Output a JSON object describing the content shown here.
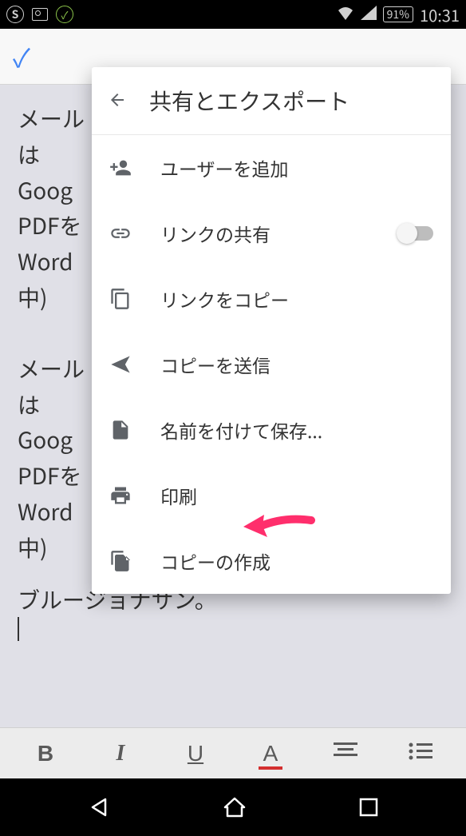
{
  "status_bar": {
    "battery": "91%",
    "time": "10:31"
  },
  "menu": {
    "title": "共有とエクスポート",
    "items": [
      {
        "label": "ユーザーを追加"
      },
      {
        "label": "リンクの共有"
      },
      {
        "label": "リンクをコピー"
      },
      {
        "label": "コピーを送信"
      },
      {
        "label": "名前を付けて保存..."
      },
      {
        "label": "印刷"
      },
      {
        "label": "コピーの作成"
      }
    ]
  },
  "document": {
    "block1": "メール\nは\nGoog\nPDFを\nWord\n中)",
    "block2": "メール\nは\nGoog\nPDFを\nWord\n中)",
    "block3": "ブルージョナサン。"
  },
  "format_bar": {
    "bold": "B",
    "italic": "I",
    "underline": "U",
    "color": "A"
  }
}
